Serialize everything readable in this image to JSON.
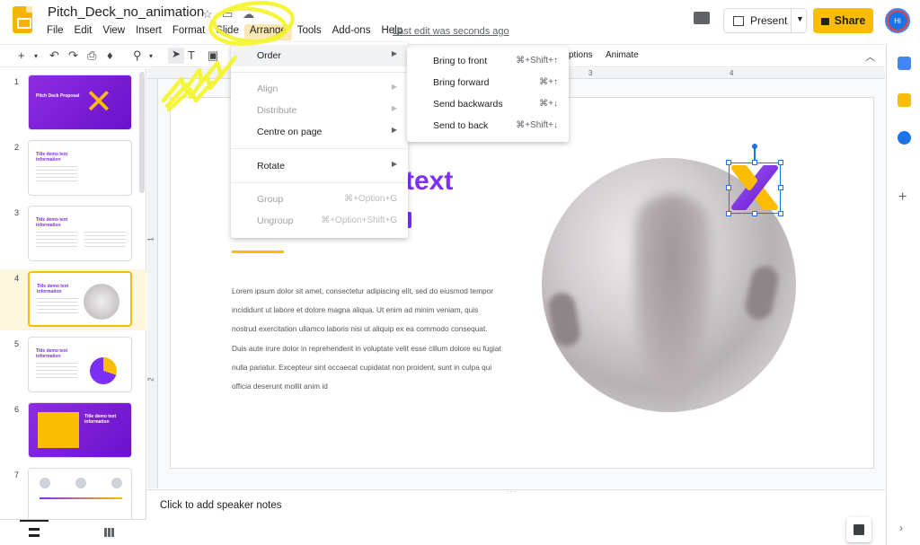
{
  "document": {
    "title": "Pitch_Deck_no_animation",
    "last_edit": "Last edit was seconds ago"
  },
  "menubar": {
    "items": [
      "File",
      "Edit",
      "View",
      "Insert",
      "Format",
      "Slide",
      "Arrange",
      "Tools",
      "Add-ons",
      "Help"
    ],
    "active": "Arrange"
  },
  "header": {
    "present_label": "Present",
    "share_label": "Share",
    "avatar_initials": "Hi"
  },
  "toolbar": {
    "options_label": "ptions",
    "animate_label": "Animate"
  },
  "ruler": {
    "top_ticks": [
      "3",
      "4"
    ],
    "left_ticks": [
      "1",
      "2"
    ]
  },
  "filmstrip": {
    "slides": [
      {
        "number": "1",
        "title": "Pitch Deck Proposal"
      },
      {
        "number": "2",
        "title": "Title demo text information"
      },
      {
        "number": "3",
        "title": "Title demo text information"
      },
      {
        "number": "4",
        "title": "Title demo text information"
      },
      {
        "number": "5",
        "title": "Title demo text information"
      },
      {
        "number": "6",
        "title": "Title demo text information"
      },
      {
        "number": "7",
        "title": ""
      }
    ],
    "selected": "4"
  },
  "slide": {
    "heading_visible": "text",
    "body": "Lorem ipsum dolor sit amet, consectetur adipiscing elit, sed do eiusmod tempor incididunt ut labore et dolore magna aliqua. Ut enim ad minim veniam, quis nostrud exercitation ullamco laboris nisi ut aliquip ex ea commodo consequat. Duis aute irure dolor in reprehenderit in voluptate velit esse cillum dolore eu fugiat nulla pariatur. Excepteur sint occaecat cupidatat non proident, sunt in culpa qui officia deserunt mollit anim id"
  },
  "notes": {
    "placeholder": "Click to add speaker notes"
  },
  "arrange_menu": {
    "order": "Order",
    "align": "Align",
    "distribute": "Distribute",
    "centre_on_page": "Centre on page",
    "rotate": "Rotate",
    "group": "Group",
    "group_shortcut": "⌘+Option+G",
    "ungroup": "Ungroup",
    "ungroup_shortcut": "⌘+Option+Shift+G"
  },
  "order_submenu": {
    "bring_to_front": "Bring to front",
    "bring_to_front_shortcut": "⌘+Shift+↑",
    "bring_forward": "Bring forward",
    "bring_forward_shortcut": "⌘+↑",
    "send_backwards": "Send backwards",
    "send_backwards_shortcut": "⌘+↓",
    "send_to_back": "Send to back",
    "send_to_back_shortcut": "⌘+Shift+↓"
  },
  "colors": {
    "brand_yellow": "#fbbc04",
    "accent_purple": "#7b2ff7",
    "selection_blue": "#1a73e8",
    "annotation_yellow": "#f5f52a"
  },
  "icons": [
    "slides-logo-icon",
    "star-icon",
    "move-folder-icon",
    "cloud-saved-icon",
    "comment-icon",
    "present-icon",
    "lock-icon",
    "calendar-icon",
    "keep-icon",
    "tasks-icon",
    "add-icon",
    "chevron-right-icon"
  ]
}
